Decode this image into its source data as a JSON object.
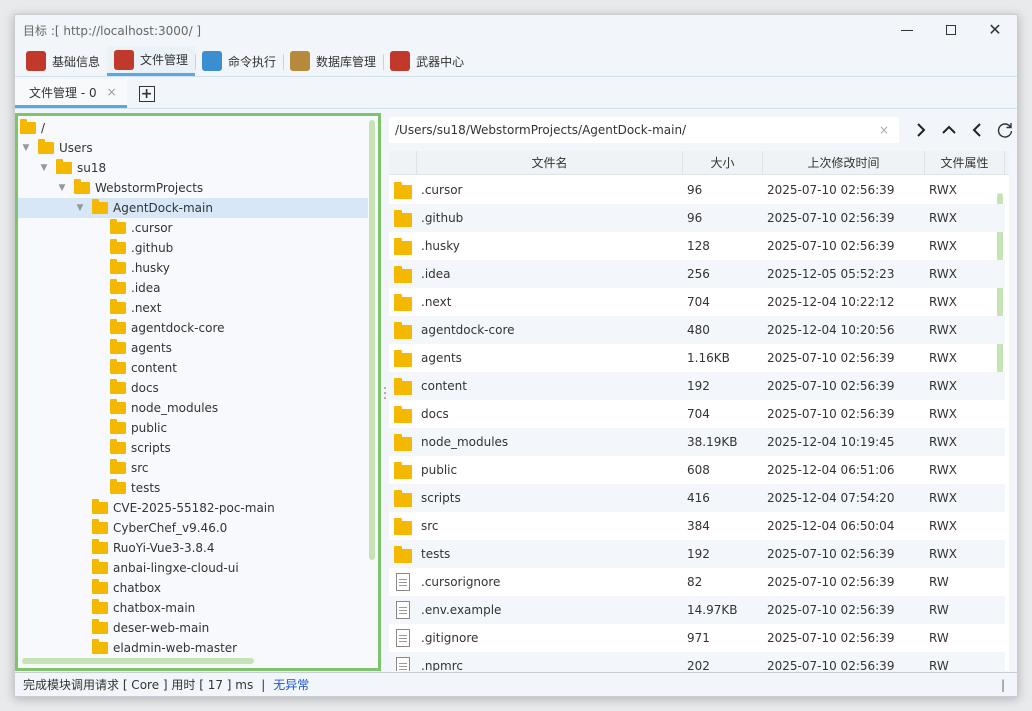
{
  "window": {
    "title": "目标 :[ http://localhost:3000/ ]"
  },
  "main_tabs": [
    {
      "label": "基础信息",
      "icon": "info-icon",
      "color": "#c0392b"
    },
    {
      "label": "文件管理",
      "icon": "file-manager-icon",
      "color": "#c0392b",
      "active": true
    },
    {
      "label": "命令执行",
      "icon": "terminal-icon",
      "color": "#3b8fd0"
    },
    {
      "label": "数据库管理",
      "icon": "database-icon",
      "color": "#b58a3c"
    },
    {
      "label": "武器中心",
      "icon": "toolbox-icon",
      "color": "#c0392b"
    }
  ],
  "sub_tab": {
    "label": "文件管理 - 0",
    "close": "×",
    "add": "+"
  },
  "tree": {
    "items": [
      {
        "label": "/",
        "depth": 0,
        "arrow": ""
      },
      {
        "label": "Users",
        "depth": 0,
        "arrow": "▼"
      },
      {
        "label": "su18",
        "depth": 1,
        "arrow": "▼"
      },
      {
        "label": "WebstormProjects",
        "depth": 2,
        "arrow": "▼"
      },
      {
        "label": "AgentDock-main",
        "depth": 3,
        "arrow": "▼",
        "selected": true
      },
      {
        "label": ".cursor",
        "depth": 4,
        "arrow": ""
      },
      {
        "label": ".github",
        "depth": 4,
        "arrow": ""
      },
      {
        "label": ".husky",
        "depth": 4,
        "arrow": ""
      },
      {
        "label": ".idea",
        "depth": 4,
        "arrow": ""
      },
      {
        "label": ".next",
        "depth": 4,
        "arrow": ""
      },
      {
        "label": "agentdock-core",
        "depth": 4,
        "arrow": ""
      },
      {
        "label": "agents",
        "depth": 4,
        "arrow": ""
      },
      {
        "label": "content",
        "depth": 4,
        "arrow": ""
      },
      {
        "label": "docs",
        "depth": 4,
        "arrow": ""
      },
      {
        "label": "node_modules",
        "depth": 4,
        "arrow": ""
      },
      {
        "label": "public",
        "depth": 4,
        "arrow": ""
      },
      {
        "label": "scripts",
        "depth": 4,
        "arrow": ""
      },
      {
        "label": "src",
        "depth": 4,
        "arrow": ""
      },
      {
        "label": "tests",
        "depth": 4,
        "arrow": ""
      },
      {
        "label": "CVE-2025-55182-poc-main",
        "depth": 3,
        "arrow": ""
      },
      {
        "label": "CyberChef_v9.46.0",
        "depth": 3,
        "arrow": ""
      },
      {
        "label": "RuoYi-Vue3-3.8.4",
        "depth": 3,
        "arrow": ""
      },
      {
        "label": "anbai-lingxe-cloud-ui",
        "depth": 3,
        "arrow": ""
      },
      {
        "label": "chatbox",
        "depth": 3,
        "arrow": ""
      },
      {
        "label": "chatbox-main",
        "depth": 3,
        "arrow": ""
      },
      {
        "label": "deser-web-main",
        "depth": 3,
        "arrow": ""
      },
      {
        "label": "eladmin-web-master",
        "depth": 3,
        "arrow": ""
      }
    ]
  },
  "path": {
    "value": "/Users/su18/WebstormProjects/AgentDock-main/",
    "clear": "×"
  },
  "nav": {
    "forward": "›",
    "up": "⌃",
    "back": "‹",
    "refresh": "↻"
  },
  "table": {
    "headers": {
      "name": "文件名",
      "size": "大小",
      "time": "上次修改时间",
      "attr": "文件属性"
    },
    "rows": [
      {
        "type": "folder",
        "name": ".cursor",
        "size": "96",
        "time": "2025-07-10 02:56:39",
        "attr": "RWX"
      },
      {
        "type": "folder",
        "name": ".github",
        "size": "96",
        "time": "2025-07-10 02:56:39",
        "attr": "RWX"
      },
      {
        "type": "folder",
        "name": ".husky",
        "size": "128",
        "time": "2025-07-10 02:56:39",
        "attr": "RWX"
      },
      {
        "type": "folder",
        "name": ".idea",
        "size": "256",
        "time": "2025-12-05 05:52:23",
        "attr": "RWX"
      },
      {
        "type": "folder",
        "name": ".next",
        "size": "704",
        "time": "2025-12-04 10:22:12",
        "attr": "RWX"
      },
      {
        "type": "folder",
        "name": "agentdock-core",
        "size": "480",
        "time": "2025-12-04 10:20:56",
        "attr": "RWX"
      },
      {
        "type": "folder",
        "name": "agents",
        "size": "1.16KB",
        "time": "2025-07-10 02:56:39",
        "attr": "RWX"
      },
      {
        "type": "folder",
        "name": "content",
        "size": "192",
        "time": "2025-07-10 02:56:39",
        "attr": "RWX"
      },
      {
        "type": "folder",
        "name": "docs",
        "size": "704",
        "time": "2025-07-10 02:56:39",
        "attr": "RWX"
      },
      {
        "type": "folder",
        "name": "node_modules",
        "size": "38.19KB",
        "time": "2025-12-04 10:19:45",
        "attr": "RWX"
      },
      {
        "type": "folder",
        "name": "public",
        "size": "608",
        "time": "2025-12-04 06:51:06",
        "attr": "RWX"
      },
      {
        "type": "folder",
        "name": "scripts",
        "size": "416",
        "time": "2025-12-04 07:54:20",
        "attr": "RWX"
      },
      {
        "type": "folder",
        "name": "src",
        "size": "384",
        "time": "2025-12-04 06:50:04",
        "attr": "RWX"
      },
      {
        "type": "folder",
        "name": "tests",
        "size": "192",
        "time": "2025-07-10 02:56:39",
        "attr": "RWX"
      },
      {
        "type": "file",
        "name": ".cursorignore",
        "size": "82",
        "time": "2025-07-10 02:56:39",
        "attr": "RW"
      },
      {
        "type": "file",
        "name": ".env.example",
        "size": "14.97KB",
        "time": "2025-07-10 02:56:39",
        "attr": "RW"
      },
      {
        "type": "file",
        "name": ".gitignore",
        "size": "971",
        "time": "2025-07-10 02:56:39",
        "attr": "RW"
      },
      {
        "type": "file",
        "name": ".npmrc",
        "size": "202",
        "time": "2025-07-10 02:56:39",
        "attr": "RW"
      }
    ]
  },
  "status": {
    "message": "完成模块调用请求 [ Core ] 用时 [ 17 ] ms",
    "separator": "|",
    "result": "无异常",
    "end": "|"
  },
  "colors": {
    "accent": "#5aa8e0",
    "tree_border": "#7ec46a",
    "folder": "#f5b800",
    "ok_text": "#1a55d6"
  }
}
